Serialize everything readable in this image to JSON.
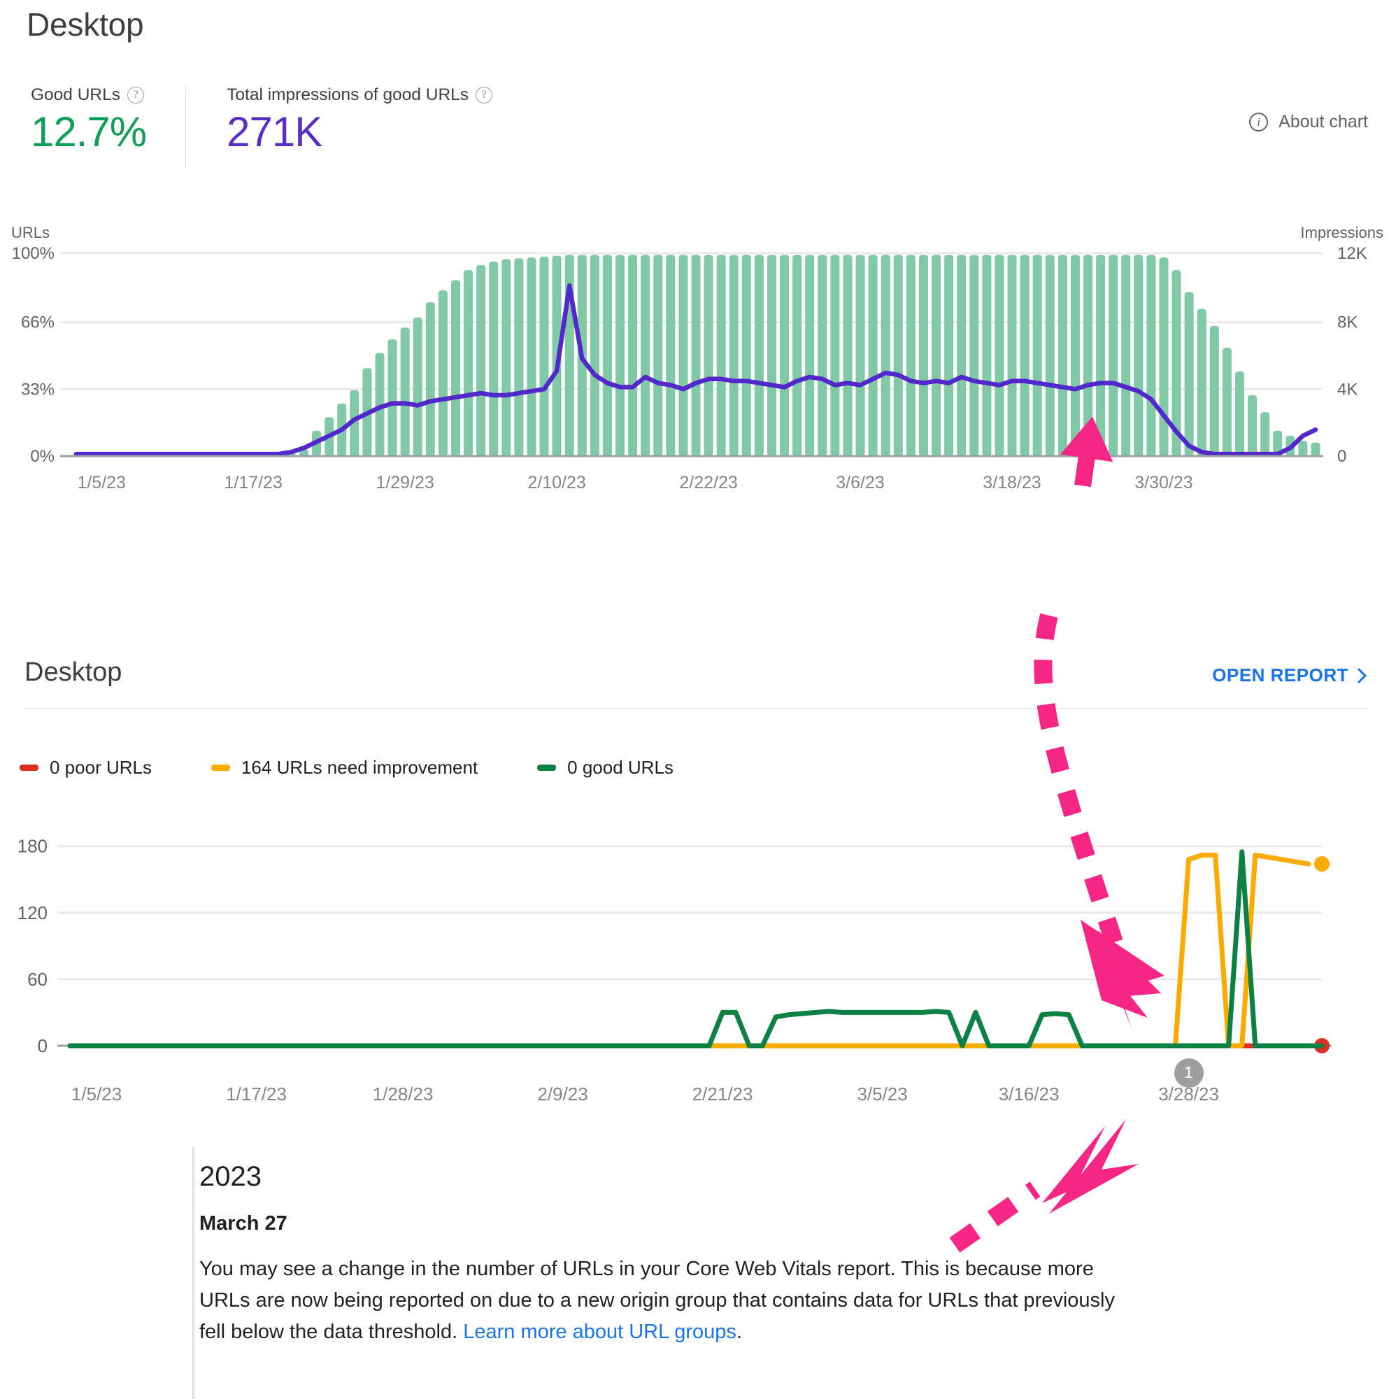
{
  "header": {
    "title": "Desktop",
    "about_chart": "About chart",
    "about_chart_icon": "info-icon",
    "metrics": [
      {
        "label": "Good URLs",
        "value": "12.7%",
        "color": "#0f9d58",
        "help_icon": "help-icon"
      },
      {
        "label": "Total impressions of good URLs",
        "value": "271K",
        "color": "#5b2ec2",
        "help_icon": "help-icon"
      }
    ]
  },
  "section2": {
    "title": "Desktop",
    "open_report": "OPEN REPORT",
    "chevron_icon": "chevron-right-icon",
    "legend": [
      {
        "label": "0 poor URLs",
        "color": "#d93025"
      },
      {
        "label": "164 URLs need improvement",
        "color": "#f9ab00"
      },
      {
        "label": "0 good URLs",
        "color": "#0d8043"
      }
    ]
  },
  "annotation": {
    "badge": "1",
    "year": "2023",
    "date": "March 27",
    "body_before": "You may see a change in the number of URLs in your Core Web Vitals report. This is because more URLs are now being reported on due to a new origin group that contains data for URLs that previously fell below the data threshold. ",
    "link_text": "Learn more about URL groups",
    "body_after": "."
  },
  "chart_data": [
    {
      "id": "good-urls-over-time",
      "type": "bar",
      "title": "Good URLs / Impressions over time",
      "xlabel": "",
      "ylabel": "URLs",
      "y2label": "Impressions",
      "ylim": [
        0,
        100
      ],
      "y2lim": [
        0,
        12000
      ],
      "yticks": [
        "0%",
        "33%",
        "66%",
        "100%"
      ],
      "ytick_values": [
        0,
        33,
        66,
        100
      ],
      "y2ticks": [
        "0",
        "4K",
        "8K",
        "12K"
      ],
      "y2tick_values": [
        0,
        4000,
        8000,
        12000
      ],
      "grid": true,
      "xticks": [
        "1/5/23",
        "1/17/23",
        "1/29/23",
        "2/10/23",
        "2/22/23",
        "3/6/23",
        "3/18/23",
        "3/30/23"
      ],
      "xtick_indices": [
        2,
        14,
        26,
        38,
        50,
        62,
        74,
        86
      ],
      "bar_color": "#81c9a6",
      "line_color": "#5227cc",
      "series": [
        {
          "name": "Impressions",
          "type": "bar",
          "axis": "right",
          "values": [
            0,
            0,
            180,
            200,
            200,
            180,
            170,
            170,
            160,
            180,
            170,
            160,
            100,
            90,
            160,
            170,
            170,
            180,
            400,
            1500,
            2300,
            3100,
            3900,
            5200,
            6100,
            6900,
            7600,
            8200,
            9100,
            9800,
            10400,
            11000,
            11300,
            11500,
            11650,
            11700,
            11750,
            11800,
            11850,
            11900,
            11900,
            11900,
            11900,
            11900,
            11900,
            11900,
            11900,
            11900,
            11900,
            11900,
            11900,
            11900,
            11900,
            11900,
            11900,
            11900,
            11900,
            11900,
            11900,
            11900,
            11900,
            11900,
            11900,
            11900,
            11900,
            11900,
            11900,
            11900,
            11900,
            11900,
            11900,
            11900,
            11900,
            11900,
            11900,
            11900,
            11900,
            11900,
            11900,
            11900,
            11900,
            11900,
            11900,
            11900,
            11900,
            11900,
            11750,
            11000,
            9700,
            8700,
            7700,
            6400,
            5000,
            3600,
            2600,
            1500,
            1200,
            900,
            800
          ]
        },
        {
          "name": "Good URLs %",
          "type": "line",
          "axis": "left",
          "values": [
            1,
            1,
            1,
            1,
            1,
            1,
            1,
            1,
            1,
            1,
            1,
            1,
            1,
            1,
            1,
            1,
            1,
            2,
            4,
            7,
            10,
            13,
            18,
            21,
            24,
            26,
            26,
            25,
            27,
            28,
            29,
            30,
            31,
            30,
            30,
            31,
            32,
            33,
            42,
            84,
            48,
            40,
            36,
            34,
            34,
            39,
            36,
            35,
            33,
            36,
            38,
            38,
            37,
            37,
            36,
            35,
            34,
            37,
            39,
            38,
            35,
            36,
            35,
            38,
            41,
            40,
            37,
            36,
            37,
            36,
            39,
            37,
            36,
            35,
            37,
            37,
            36,
            35,
            34,
            33,
            35,
            36,
            36,
            34,
            32,
            28,
            20,
            12,
            5,
            2,
            1,
            1,
            1,
            1,
            1,
            1,
            4,
            10,
            13
          ]
        }
      ]
    },
    {
      "id": "core-web-vitals-urls",
      "type": "line",
      "title": "URL status over time",
      "xlabel": "",
      "ylabel": "",
      "ylim": [
        0,
        200
      ],
      "yticks": [
        "0",
        "60",
        "120",
        "180"
      ],
      "ytick_values": [
        0,
        60,
        120,
        180
      ],
      "grid": true,
      "xticks": [
        "1/5/23",
        "1/17/23",
        "1/28/23",
        "2/9/23",
        "2/21/23",
        "3/5/23",
        "3/16/23",
        "3/28/23"
      ],
      "xtick_indices": [
        2,
        14,
        25,
        37,
        49,
        61,
        72,
        84
      ],
      "series": [
        {
          "name": "0 poor URLs",
          "color": "#d93025",
          "endpoint": true,
          "values": [
            0,
            0,
            0,
            0,
            0,
            0,
            0,
            0,
            0,
            0,
            0,
            0,
            0,
            0,
            0,
            0,
            0,
            0,
            0,
            0,
            0,
            0,
            0,
            0,
            0,
            0,
            0,
            0,
            0,
            0,
            0,
            0,
            0,
            0,
            0,
            0,
            0,
            0,
            0,
            0,
            0,
            0,
            0,
            0,
            0,
            0,
            0,
            0,
            0,
            0,
            0,
            0,
            0,
            0,
            0,
            0,
            0,
            0,
            0,
            0,
            0,
            0,
            0,
            0,
            0,
            0,
            0,
            0,
            0,
            0,
            0,
            0,
            0,
            0,
            0,
            0,
            0,
            0,
            0,
            0,
            0,
            0,
            0,
            0,
            0,
            0,
            0,
            0,
            0,
            0,
            0,
            0,
            0,
            0,
            0
          ]
        },
        {
          "name": "164 URLs need improvement",
          "color": "#f9ab00",
          "endpoint": true,
          "values": [
            0,
            0,
            0,
            0,
            0,
            0,
            0,
            0,
            0,
            0,
            0,
            0,
            0,
            0,
            0,
            0,
            0,
            0,
            0,
            0,
            0,
            0,
            0,
            0,
            0,
            0,
            0,
            0,
            0,
            0,
            0,
            0,
            0,
            0,
            0,
            0,
            0,
            0,
            0,
            0,
            0,
            0,
            0,
            0,
            0,
            0,
            0,
            0,
            0,
            0,
            0,
            0,
            0,
            0,
            0,
            0,
            0,
            0,
            0,
            0,
            0,
            0,
            0,
            0,
            0,
            0,
            0,
            0,
            0,
            0,
            0,
            0,
            0,
            0,
            0,
            0,
            0,
            0,
            0,
            0,
            0,
            0,
            0,
            0,
            168,
            172,
            172,
            0,
            0,
            172,
            170,
            168,
            166,
            164
          ]
        },
        {
          "name": "0 good URLs",
          "color": "#0d8043",
          "endpoint": false,
          "values": [
            0,
            0,
            0,
            0,
            0,
            0,
            0,
            0,
            0,
            0,
            0,
            0,
            0,
            0,
            0,
            0,
            0,
            0,
            0,
            0,
            0,
            0,
            0,
            0,
            0,
            0,
            0,
            0,
            0,
            0,
            0,
            0,
            0,
            0,
            0,
            0,
            0,
            0,
            0,
            0,
            0,
            0,
            0,
            0,
            0,
            0,
            0,
            0,
            0,
            30,
            30,
            0,
            0,
            26,
            28,
            29,
            30,
            31,
            30,
            30,
            30,
            30,
            30,
            30,
            30,
            31,
            30,
            0,
            30,
            0,
            0,
            0,
            0,
            28,
            29,
            28,
            0,
            0,
            0,
            0,
            0,
            0,
            0,
            0,
            0,
            0,
            0,
            0,
            175,
            0,
            0,
            0,
            0,
            0,
            0
          ]
        }
      ]
    }
  ]
}
